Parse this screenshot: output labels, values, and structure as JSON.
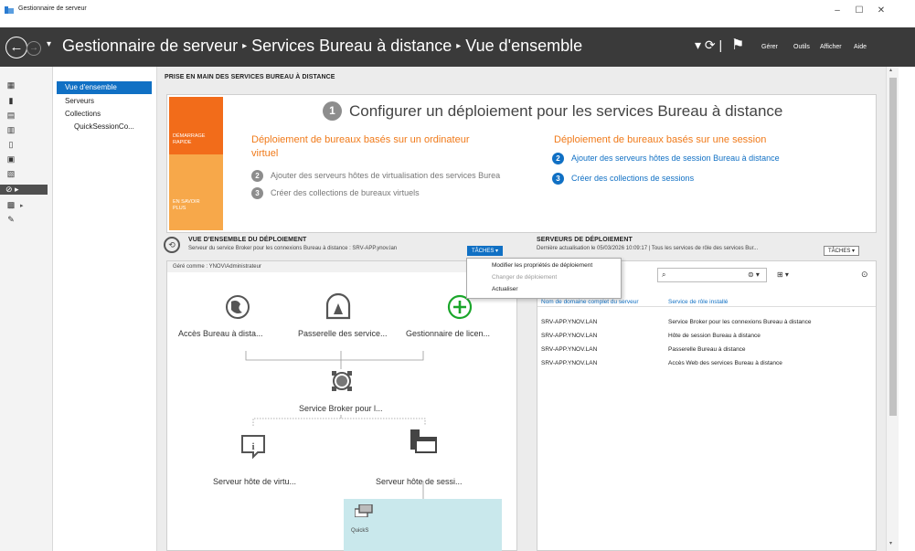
{
  "window": {
    "title": "Gestionnaire de serveur",
    "controls": [
      "–",
      "☐",
      "✕"
    ]
  },
  "header": {
    "breadcrumb": [
      "Gestionnaire de serveur",
      "Services Bureau à distance",
      "Vue d'ensemble"
    ],
    "menu": [
      "Gérer",
      "Outils",
      "Afficher",
      "Aide"
    ]
  },
  "nav": {
    "items": [
      {
        "label": "Vue d'ensemble",
        "selected": true
      },
      {
        "label": "Serveurs"
      },
      {
        "label": "Collections"
      },
      {
        "label": "QuickSessionCo..."
      }
    ]
  },
  "quickstart": {
    "section_title": "PRISE EN MAIN DES SERVICES BUREAU À DISTANCE",
    "tile_top": [
      "DÉMARRAGE",
      "RAPIDE"
    ],
    "tile_bottom": [
      "EN SAVOIR",
      "PLUS"
    ],
    "step1_num": "1",
    "headline": "Configurer un déploiement pour les services Bureau à distance",
    "vdi_title": [
      "Déploiement de bureaux basés sur un ordinateur",
      "virtuel"
    ],
    "vdi_steps": [
      {
        "num": "2",
        "text": "Ajouter des serveurs hôtes de virtualisation des services Burea"
      },
      {
        "num": "3",
        "text": "Créer des collections de bureaux virtuels"
      }
    ],
    "session_title": "Déploiement de bureaux basés sur une session",
    "session_steps": [
      {
        "num": "2",
        "text": "Ajouter des serveurs hôtes de session Bureau à distance"
      },
      {
        "num": "3",
        "text": "Créer des collections de sessions"
      }
    ]
  },
  "deployment": {
    "title": "VUE D'ENSEMBLE DU DÉPLOIEMENT",
    "subtitle": "Serveur du service Broker pour les connexions Bureau à distance : SRV-APP.ynov.lan",
    "tasks_label": "TÂCHES",
    "managed_as": "Géré comme : YNOV\\Administrateur",
    "nodes": {
      "web": "Accès Bureau à dista...",
      "gateway": "Passerelle des service...",
      "licensing": "Gestionnaire de licen...",
      "broker": "Service Broker pour l...",
      "virt_host": "Serveur hôte de virtu...",
      "session_host": "Serveur hôte de sessi...",
      "collection": "QuickS"
    },
    "menu": [
      {
        "label": "Modifier les propriétés de déploiement",
        "enabled": true
      },
      {
        "label": "Changer de déploiement",
        "enabled": false
      },
      {
        "label": "Actualiser",
        "enabled": true
      }
    ]
  },
  "servers": {
    "title": "SERVEURS DE DÉPLOIEMENT",
    "subtitle": "Dernière actualisation le 05/03/2026 10:09:17 | Tous les services de rôle des services Bur...",
    "tasks_label": "TÂCHES",
    "columns": [
      "Nom de domaine complet du serveur",
      "Service de rôle installé"
    ],
    "rows": [
      [
        "SRV-APP.YNOV.LAN",
        "Service Broker pour les connexions Bureau à distance"
      ],
      [
        "SRV-APP.YNOV.LAN",
        "Hôte de session Bureau à distance"
      ],
      [
        "SRV-APP.YNOV.LAN",
        "Passerelle Bureau à distance"
      ],
      [
        "SRV-APP.YNOV.LAN",
        "Accès Web des services Bureau à distance"
      ]
    ]
  },
  "colors": {
    "accent": "#1070c4",
    "orange": "#f26c1a",
    "orange_light": "#f7a84a",
    "header": "#3a3a3a",
    "green": "#1aa62a"
  }
}
